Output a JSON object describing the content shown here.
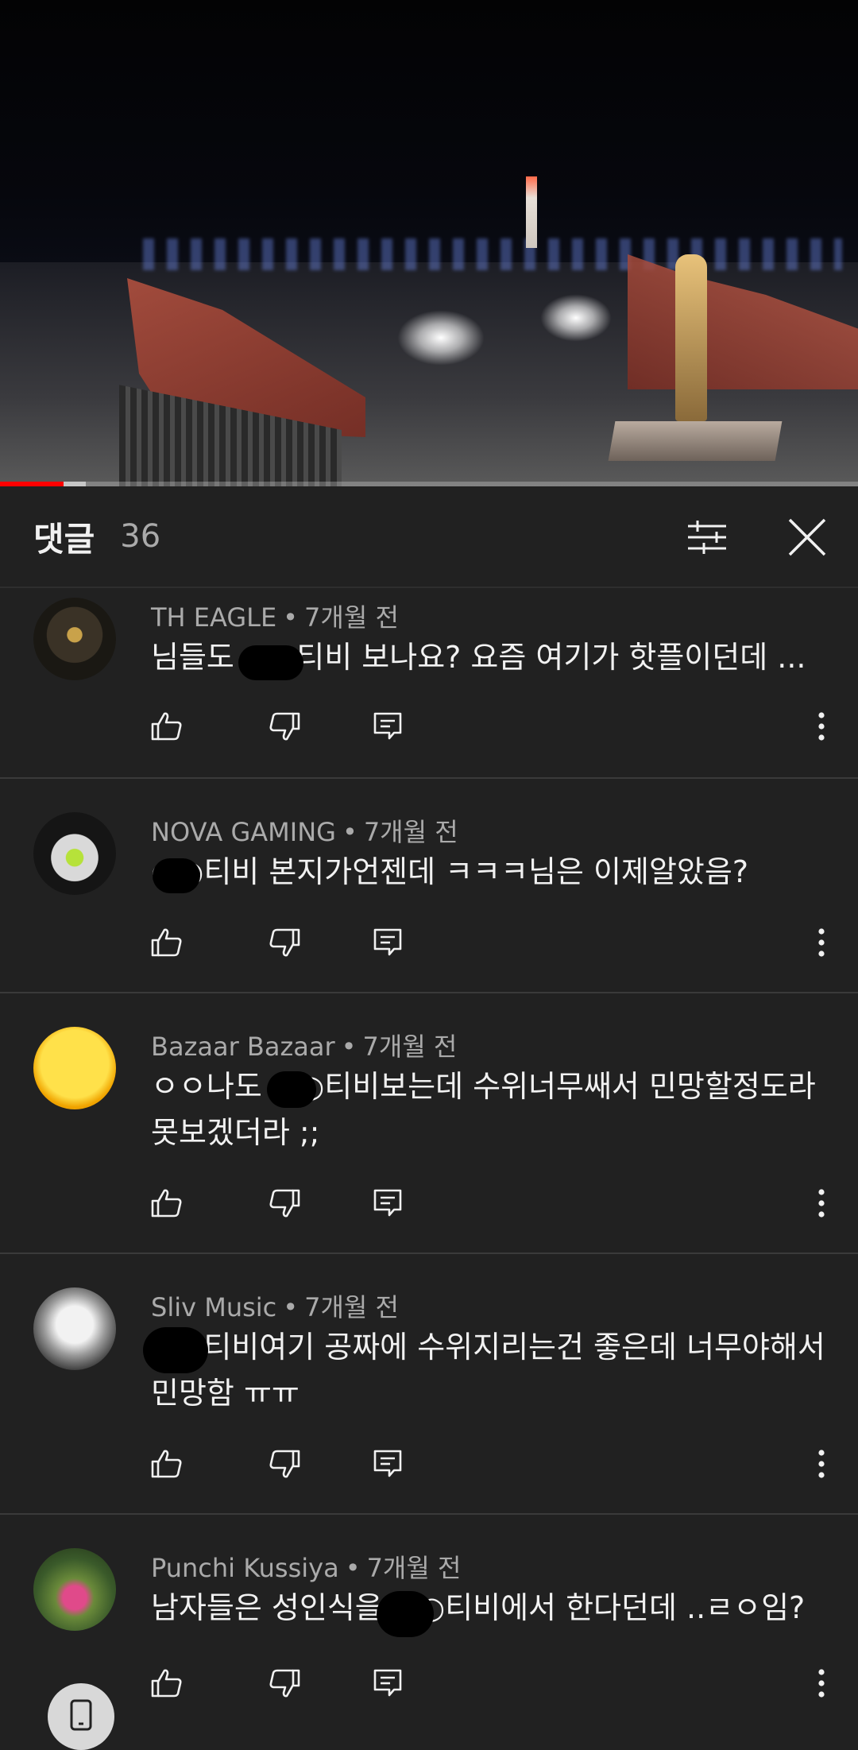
{
  "player": {
    "progress_played_fraction": 0.074,
    "progress_buffered_fraction": 0.1
  },
  "comments_header": {
    "title": "댓글",
    "count": "36",
    "filter_icon": "sliders-icon",
    "close_icon": "close-icon"
  },
  "comments": [
    {
      "author": "TH EAGLE",
      "time": "7개월 전",
      "text": "님들도 ○○티비 보나요? 요즘 여기가 핫플이던데 ..."
    },
    {
      "author": "NOVA GAMING",
      "time": "7개월 전",
      "text": "○○티비 본지가언젠데 ㅋㅋㅋ님은 이제알았음?"
    },
    {
      "author": "Bazaar Bazaar",
      "time": "7개월 전",
      "text": "ㅇㅇ나도 ○○티비보는데 수위너무쌔서 민망할정도라 못보겠더라 ;;"
    },
    {
      "author": "Sliv Music",
      "time": "7개월 전",
      "text": "○○티비여기 공짜에 수위지리는건 좋은데 너무야해서 민망함 ㅠㅠ"
    },
    {
      "author": "Punchi Kussiya",
      "time": "7개월 전",
      "text": "남자들은 성인식을 ○○티비에서 한다던데 ..ㄹㅇ임?"
    }
  ],
  "separator": "•",
  "icons": {
    "like": "thumbs-up-icon",
    "dislike": "thumbs-down-icon",
    "reply": "reply-icon",
    "more": "more-vert-icon",
    "fab": "phone-icon"
  },
  "colors": {
    "background": "#212121",
    "text_primary": "#f1f1f1",
    "text_secondary": "#aaaaaa",
    "progress": "#ff0000"
  }
}
